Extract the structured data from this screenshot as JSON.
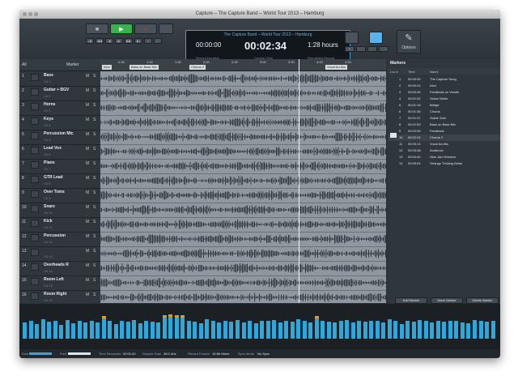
{
  "window": {
    "title": "Capture – The Capture Band – World Tour 2013 – Hamburg"
  },
  "transport": {
    "stop": "■",
    "play": "▶",
    "record": "●"
  },
  "lcd": {
    "project": "The Capture Band – World Tour 2013 – Hamburg",
    "record_duration": "00:00:00",
    "record_duration_label": "Record Duration",
    "current_time": "00:02:34",
    "current_time_label": "Current Time",
    "remaining": "1:28 hours",
    "remaining_label": "Remaining Record"
  },
  "options_label": "Options",
  "track_header": {
    "all": "All",
    "marker": "Marker"
  },
  "tracks": [
    {
      "num": "1",
      "name": "Bass",
      "ch": "Ch 1"
    },
    {
      "num": "2",
      "name": "Guitar + BGV",
      "ch": "Ch 2"
    },
    {
      "num": "3",
      "name": "Horns",
      "ch": "Ch 3"
    },
    {
      "num": "4",
      "name": "Keys",
      "ch": "Ch 4"
    },
    {
      "num": "5",
      "name": "Percussion Mic",
      "ch": "Ch 5"
    },
    {
      "num": "6",
      "name": "Lead Vox",
      "ch": "Ch 6"
    },
    {
      "num": "7",
      "name": "Piano",
      "ch": "Ch 7"
    },
    {
      "num": "8",
      "name": "GTR Lead",
      "ch": "Ch 8"
    },
    {
      "num": "9",
      "name": "Over Toms",
      "ch": "Ch 9"
    },
    {
      "num": "10",
      "name": "Snare",
      "ch": "Ch 10"
    },
    {
      "num": "11",
      "name": "Kick",
      "ch": "Ch 11"
    },
    {
      "num": "12",
      "name": "Percussion",
      "ch": "Ch 12"
    },
    {
      "num": "13",
      "name": "",
      "ch": "Ch 13"
    },
    {
      "num": "14",
      "name": "Overheads R",
      "ch": "Ch 14"
    },
    {
      "num": "15",
      "name": "Room Left",
      "ch": "Ch 15"
    },
    {
      "num": "16",
      "name": "Room Right",
      "ch": "Ch 16"
    }
  ],
  "ruler": {
    "ticks": [
      "0:30",
      "1:00",
      "1:30",
      "2:00",
      "2:30",
      "3:00",
      "3:30",
      "4:00",
      "4:30"
    ]
  },
  "lane_markers": [
    "Intro",
    "Bass on Base Mic",
    "Chorus 2",
    "Vocal Ad-libs"
  ],
  "markers_panel": {
    "title": "Markers",
    "cols": {
      "num": "Loc #",
      "time": "Time",
      "name": "Name"
    },
    "rows": [
      {
        "n": "1",
        "time": "00:00:00",
        "name": "The Capture Song"
      },
      {
        "n": "2",
        "time": "00:00:24",
        "name": "Intro"
      },
      {
        "n": "3",
        "time": "00:00:46",
        "name": "Feedback on Vocals"
      },
      {
        "n": "4",
        "time": "00:01:02",
        "name": "Guitar Noise"
      },
      {
        "n": "5",
        "time": "00:01:16",
        "name": "Bridge"
      },
      {
        "n": "6",
        "time": "00:01:38",
        "name": "Chorus"
      },
      {
        "n": "7",
        "time": "00:01:47",
        "name": "Guitar Solo"
      },
      {
        "n": "8",
        "time": "00:01:59",
        "name": "Bass on Base Mic"
      },
      {
        "n": "9",
        "time": "00:02:08",
        "name": "Feedback"
      },
      {
        "n": "10",
        "time": "00:02:24",
        "name": "Chorus 2"
      },
      {
        "n": "11",
        "time": "00:03:13",
        "name": "Vocal Ad-libs"
      },
      {
        "n": "12",
        "time": "00:03:38",
        "name": "Audience"
      },
      {
        "n": "13",
        "time": "00:04:40",
        "name": "New Jam Session"
      },
      {
        "n": "14",
        "time": "00:05:04",
        "name": "Strange Tricking Noise"
      }
    ],
    "add": "Add Marker",
    "move": "Move Marker",
    "delete": "Delete Marker"
  },
  "meter_levels": [
    0.55,
    0.62,
    0.5,
    0.66,
    0.58,
    0.6,
    0.48,
    0.64,
    0.52,
    0.6,
    0.57,
    0.62,
    0.55,
    0.7,
    0.6,
    0.5,
    0.62,
    0.58,
    0.64,
    0.52,
    0.6,
    0.58,
    0.55,
    0.72,
    0.74,
    0.73,
    0.72,
    0.6,
    0.58,
    0.52,
    0.66,
    0.6,
    0.55,
    0.62,
    0.58,
    0.64,
    0.57,
    0.6,
    0.54,
    0.62,
    0.6,
    0.65,
    0.55,
    0.62,
    0.58,
    0.66,
    0.6,
    0.55,
    0.7,
    0.62,
    0.58,
    0.55,
    0.6,
    0.64,
    0.57,
    0.6,
    0.58,
    0.62,
    0.6,
    0.55,
    0.66,
    0.62,
    0.5,
    0.6,
    0.58,
    0.64,
    0.6,
    0.55,
    0.62,
    0.58,
    0.6,
    0.6,
    0.56,
    0.52,
    0.64,
    0.6,
    0.58,
    0.62
  ],
  "status": {
    "disk": "Disk",
    "free": "Free",
    "time_recorded": "Time Recorded",
    "time_recorded_val": "00:01:42",
    "sample_rate": "Sample Rate",
    "sample_rate_val": "48.0 kHz",
    "record_format": "Record Format",
    "record_format_val": "16 Bit Wave",
    "sync_mode": "Sync Mode",
    "sync_mode_val": "No Sync"
  },
  "colors": {
    "accent": "#5ab3ea",
    "play": "#37b24d",
    "meter": "#2ea8dc"
  }
}
